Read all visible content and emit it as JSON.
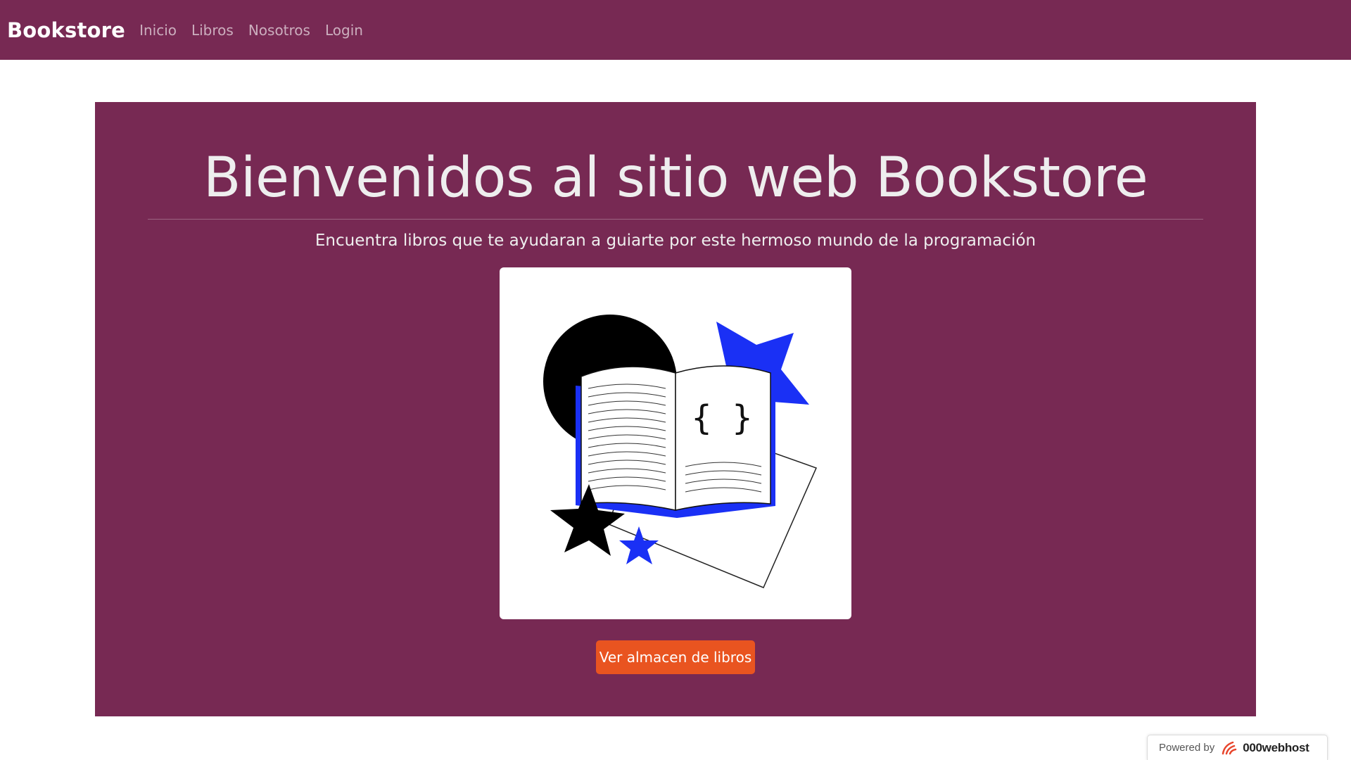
{
  "navbar": {
    "brand": "Bookstore",
    "links": [
      {
        "label": "Inicio"
      },
      {
        "label": "Libros"
      },
      {
        "label": "Nosotros"
      },
      {
        "label": "Login"
      }
    ],
    "background_color": "#772953"
  },
  "hero": {
    "title": "Bienvenidos al sitio web Bookstore",
    "subtitle": "Encuentra libros que te ayudaran a guiarte por este hermoso mundo de la programación",
    "illustration": {
      "icon": "open-book-illustration",
      "book_text": "{ }"
    },
    "button_label": "Ver almacen de libros",
    "button_color": "#e95420",
    "background_color": "#772953"
  },
  "footer_badge": {
    "powered_label": "Powered by",
    "host_name": "000webhost",
    "logo_icon": "000webhost-logo-icon"
  }
}
